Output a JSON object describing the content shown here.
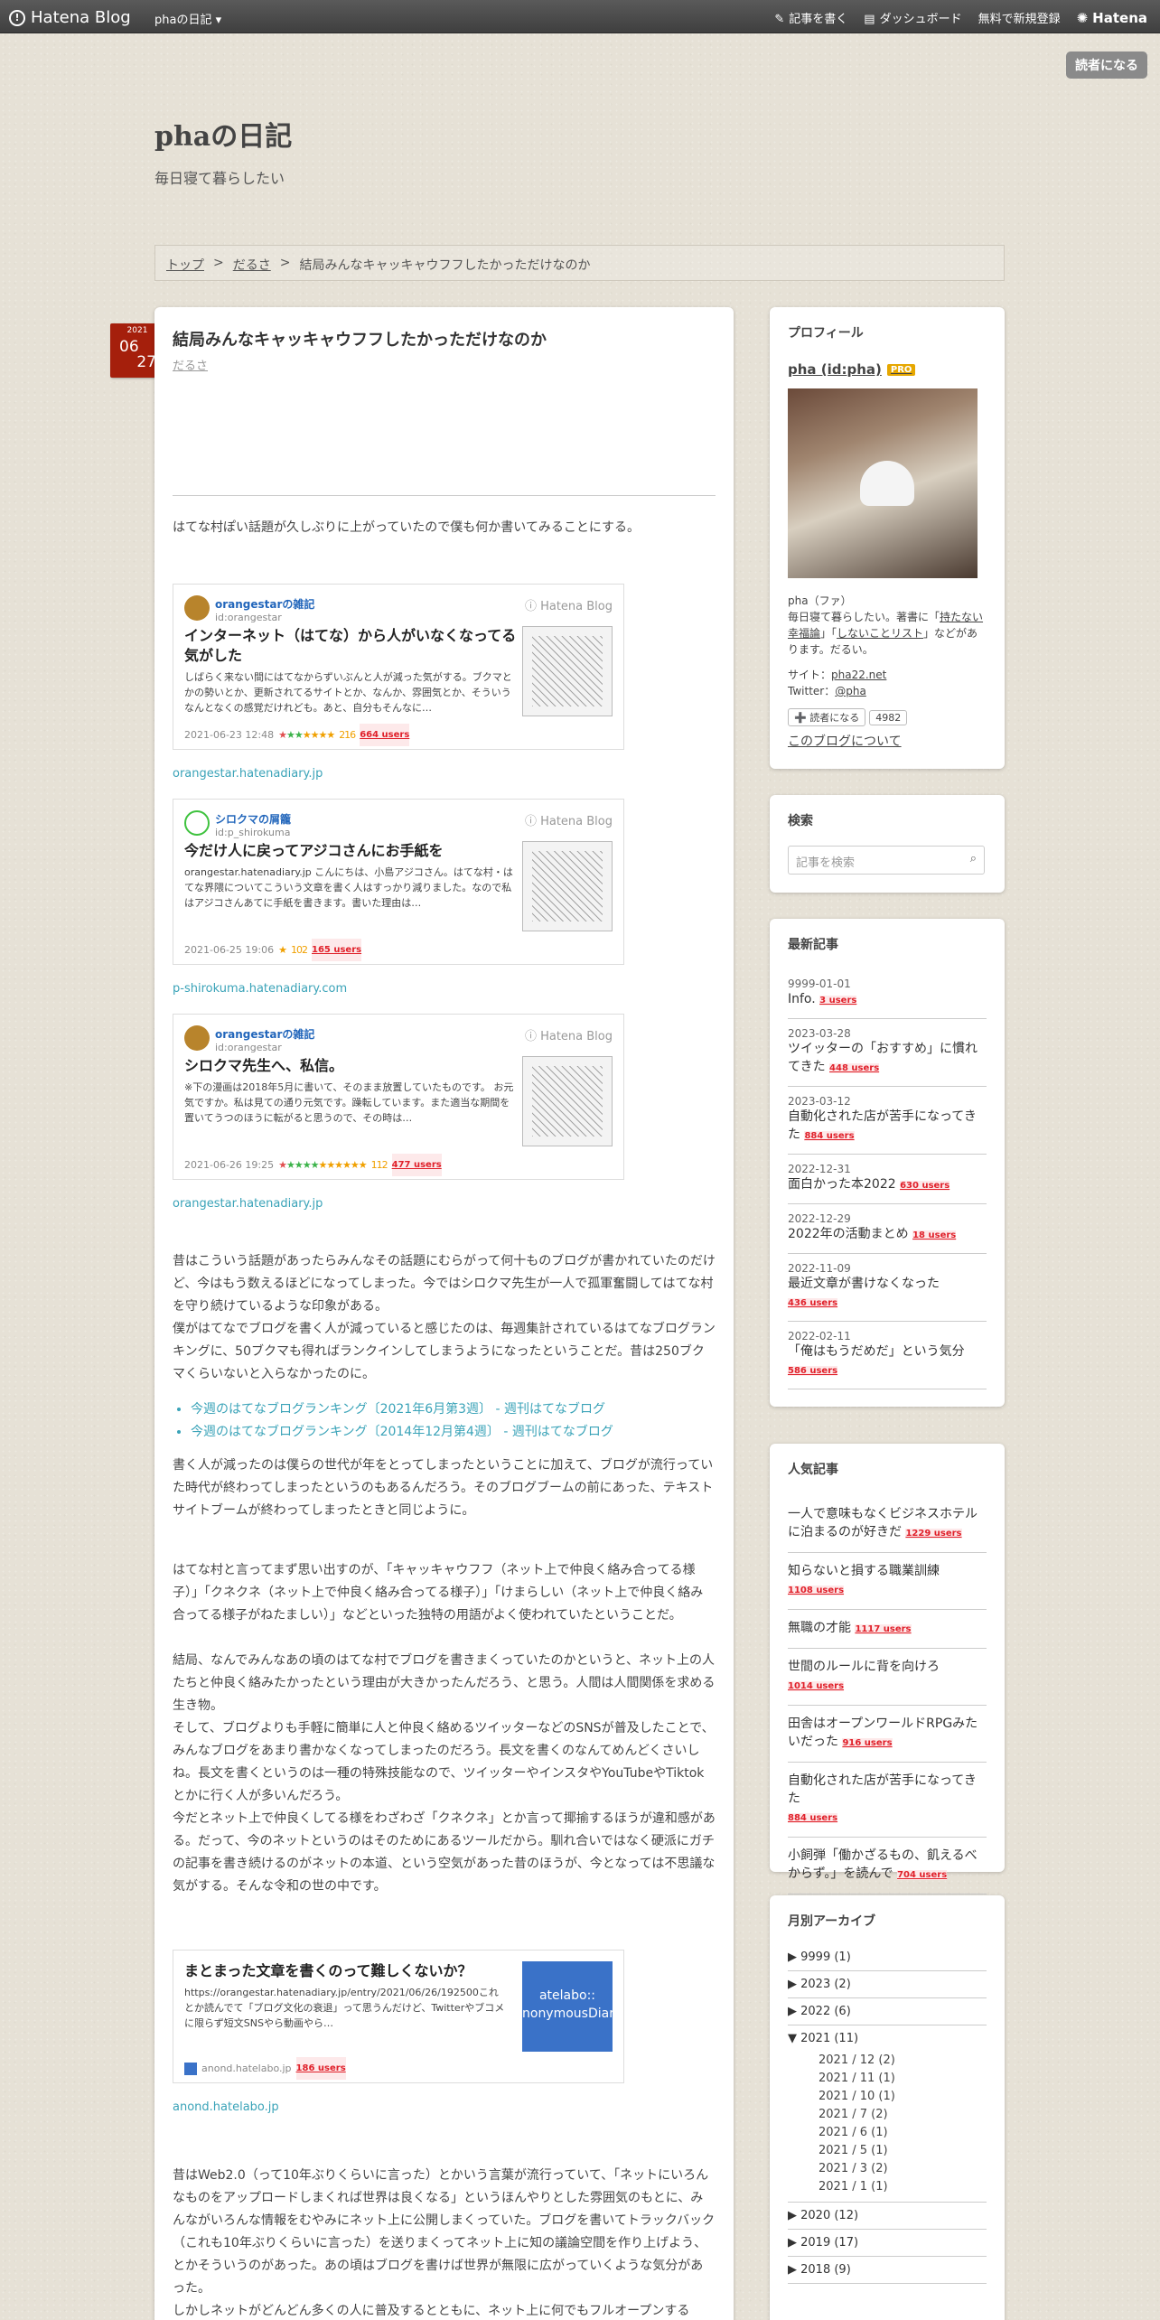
{
  "topbar": {
    "logo": "Hatena Blog",
    "blog_menu": "phaの日記 ▾",
    "write": "記事を書く",
    "dashboard": "ダッシュボード",
    "signup": "無料で新規登録",
    "hatena": "Hatena"
  },
  "reader_button": "読者になる",
  "header": {
    "title": "phaの日記",
    "description": "毎日寝て暮らしたい"
  },
  "breadcrumb": {
    "top": "トップ",
    "sep1": ">",
    "category": "だるさ",
    "sep2": ">",
    "current": "結局みんなキャッキャウフフしたかっただけなのか"
  },
  "date": {
    "year": "2021",
    "month": "06",
    "day": "27"
  },
  "entry": {
    "title": "結局みんなキャッキャウフフしたかっただけなのか",
    "category": "だるさ",
    "intro": "はてな村ぽい話題が久しぶりに上がっていたので僕も何か書いてみることにする。",
    "cards": [
      {
        "name": "orangestarの雑記",
        "id": "id:orangestar",
        "service": "Hatena Blog",
        "title": "インターネット（はてな）から人がいなくなってる気がした",
        "excerpt": "しばらく来ない間にはてなからずいぶんと人が減った気がする。ブクマとかの勢いとか、更新されてるサイトとか、なんか、雰囲気とか、そういうなんとなくの感覚だけれども。あと、自分もそんなに…",
        "date": "2021-06-23 12:48",
        "stars": "★★★★",
        "star_count": "216",
        "users": "664 users",
        "source": "orangestar.hatenadiary.jp"
      },
      {
        "name": "シロクマの屑籠",
        "id": "id:p_shirokuma",
        "service": "Hatena Blog",
        "title": "今だけ人に戻ってアジコさんにお手紙を",
        "excerpt": "orangestar.hatenadiary.jp こんにちは、小島アジコさん。はてな村・はてな界隈についてこういう文章を書く人はすっかり減りました。なので私はアジコさんあてに手紙を書きます。書いた理由は…",
        "date": "2021-06-25 19:06",
        "stars": "★",
        "star_count": "102",
        "users": "165 users",
        "source": "p-shirokuma.hatenadiary.com"
      },
      {
        "name": "orangestarの雑記",
        "id": "id:orangestar",
        "service": "Hatena Blog",
        "title": "シロクマ先生へ、私信。",
        "excerpt": "※下の漫画は2018年5月に書いて、そのまま放置していたものです。 お元気ですか。私は見ての通り元気です。躁転しています。また適当な期間を置いてうつのほうに転がると思うので、その時は…",
        "date": "2021-06-26 19:25",
        "stars": "★★★★★★",
        "star_count": "112",
        "users": "477 users",
        "source": "orangestar.hatenadiary.jp"
      }
    ],
    "para1": [
      "昔はこういう話題があったらみんなその話題にむらがって何十ものブログが書かれていたのだけど、今はもう数えるほどになってしまった。今ではシロクマ先生が一人で孤軍奮闘してはてな村を守り続けているような印象がある。",
      "僕がはてなでブログを書く人が減っていると感じたのは、毎週集計されているはてなブログランキングに、50ブクマも得ればランクインしてしまうようになったということだ。昔は250ブクマくらいないと入らなかったのに。"
    ],
    "links": [
      "今週のはてなブログランキング〔2021年6月第3週〕 - 週刊はてなブログ",
      "今週のはてなブログランキング〔2014年12月第4週〕 - 週刊はてなブログ"
    ],
    "para2": "書く人が減ったのは僕らの世代が年をとってしまったということに加えて、ブログが流行っていた時代が終わってしまったというのもあるんだろう。そのブログブームの前にあった、テキストサイトブームが終わってしまったときと同じように。",
    "para3": [
      "はてな村と言ってまず思い出すのが、「キャッキャウフフ（ネット上で仲良く絡み合ってる様子）」「クネクネ（ネット上で仲良く絡み合ってる様子）」「けまらしい（ネット上で仲良く絡み合ってる様子がねたましい）」などといった独特の用語がよく使われていたということだ。",
      "結局、なんでみんなあの頃のはてな村でブログを書きまくっていたのかというと、ネット上の人たちと仲良く絡みたかったという理由が大きかったんだろう、と思う。人間は人間関係を求める生き物。",
      "そして、ブログよりも手軽に簡単に人と仲良く絡めるツイッターなどのSNSが普及したことで、みんなブログをあまり書かなくなってしまったのだろう。長文を書くのなんてめんどくさいしね。長文を書くというのは一種の特殊技能なので、ツイッターやインスタやYouTubeやTiktokとかに行く人が多いんだろう。",
      "今だとネット上で仲良くしてる様をわざわざ「クネクネ」とか言って揶揄するほうが違和感がある。だって、今のネットというのはそのためにあるツールだから。馴れ合いではなく硬派にガチの記事を書き続けるのがネットの本道、という空気があった昔のほうが、今となっては不思議な気がする。そんな令和の世の中です。"
    ],
    "card4": {
      "title": "まとまった文章を書くのって難しくないか？",
      "excerpt": "https://orangestar.hatenadiary.jp/entry/2021/06/26/192500これとか読んでて「ブログ文化の衰退」って思うんだけど、Twitterやブコメに限らず短文SNSやら動画やら…",
      "thumb_text": "atelabo:: nonymousDiar",
      "site": "anond.hatelabo.jp",
      "users": "186 users",
      "source": "anond.hatelabo.jp"
    },
    "para4": [
      "昔はWeb2.0（って10年ぶりくらいに言った）とかいう言葉が流行っていて、「ネットにいろんなものをアップロードしまくれば世界は良くなる」というほんやりとした雰囲気のもとに、みんながいろんな情報をむやみにネット上に公開しまくっていた。ブログを書いてトラックバック（これも10年ぶりくらいに言った）を送りまくってネット上に知の議論空間を作り上げよう、とかそういうのがあった。あの頃はブログを書けば世界が無限に広がっていくような気分があった。",
      "しかしネットがどんどん多くの人に普及するとともに、ネット上に何でもフルオープンする"
    ]
  },
  "sidebar": {
    "profile": {
      "heading": "プロフィール",
      "name": "pha (id:pha)",
      "pro": "PRO",
      "kana": "pha（ファ）",
      "bio_pre": "毎日寝て暮らしたい。著書に「",
      "book1": "持たない幸福論",
      "bio_mid": "」「",
      "book2": "しないことリスト",
      "bio_post": "」などがあります。だるい。",
      "site_label": "サイト：",
      "site": "pha22.net",
      "twitter_label": "Twitter：",
      "twitter": "@pha",
      "reader_btn": "➕ 読者になる",
      "reader_count": "4982",
      "about": "このブログについて"
    },
    "search": {
      "heading": "検索",
      "placeholder": "記事を検索"
    },
    "recent": {
      "heading": "最新記事",
      "items": [
        {
          "date": "9999-01-01",
          "title": "Info.",
          "users": "3 users"
        },
        {
          "date": "2023-03-28",
          "title": "ツイッターの「おすすめ」に慣れてきた",
          "users": "448 users"
        },
        {
          "date": "2023-03-12",
          "title": "自動化された店が苦手になってきた",
          "users": "884 users"
        },
        {
          "date": "2022-12-31",
          "title": "面白かった本2022",
          "users": "630 users"
        },
        {
          "date": "2022-12-29",
          "title": "2022年の活動まとめ",
          "users": "18 users"
        },
        {
          "date": "2022-11-09",
          "title": "最近文章が書けなくなった",
          "users": "436 users"
        },
        {
          "date": "2022-02-11",
          "title": "「俺はもうだめだ」という気分",
          "users": "586 users"
        }
      ]
    },
    "popular": {
      "heading": "人気記事",
      "items": [
        {
          "title": "一人で意味もなくビジネスホテルに泊まるのが好きだ",
          "users": "1229 users"
        },
        {
          "title": "知らないと損する職業訓練",
          "users": "1108 users"
        },
        {
          "title": "無職の才能",
          "users": "1117 users"
        },
        {
          "title": "世間のルールに背を向けろ",
          "users": "1014 users"
        },
        {
          "title": "田舎はオープンワールドRPGみたいだった",
          "users": "916 users"
        },
        {
          "title": "自動化された店が苦手になってきた",
          "users": "884 users"
        },
        {
          "title": "小飼弾「働かざるもの、飢えるべからず。」を読んで",
          "users": "704 users"
        }
      ]
    },
    "archive": {
      "heading": "月別アーカイブ",
      "items": [
        {
          "label": "9999 (1)",
          "open": false
        },
        {
          "label": "2023 (2)",
          "open": false
        },
        {
          "label": "2022 (6)",
          "open": false
        },
        {
          "label": "2021 (11)",
          "open": true
        },
        {
          "label": "2020 (12)",
          "open": false
        },
        {
          "label": "2019 (17)",
          "open": false
        },
        {
          "label": "2018 (9)",
          "open": false
        }
      ],
      "months_2021": [
        "2021 / 12 (2)",
        "2021 / 11 (1)",
        "2021 / 10 (1)",
        "2021 / 7 (2)",
        "2021 / 6 (1)",
        "2021 / 5 (1)",
        "2021 / 3 (2)",
        "2021 / 1 (1)"
      ]
    }
  },
  "colors": {
    "topbar": "#4a4a4a",
    "date_badge": "#a51f0c",
    "link": "#3aa3b8",
    "users": "#e0202a"
  }
}
